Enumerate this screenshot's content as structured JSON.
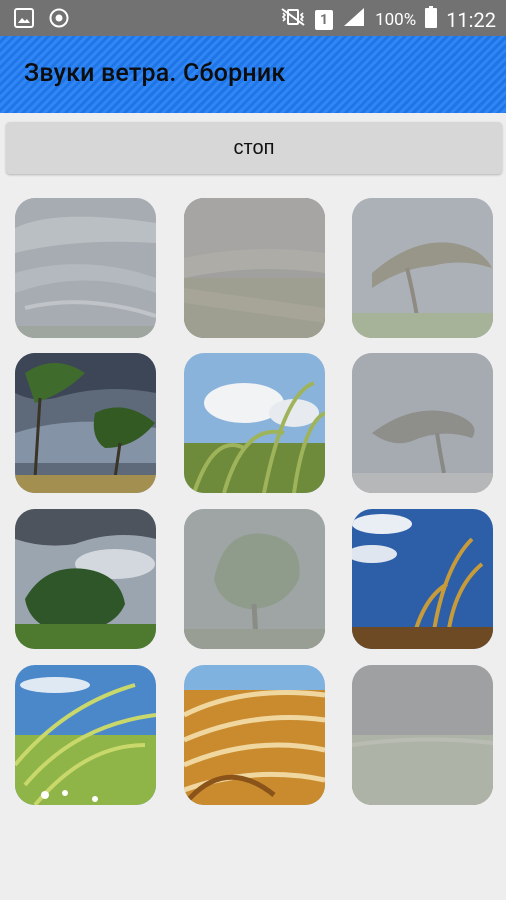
{
  "status_bar": {
    "left_icons": [
      "gallery-icon",
      "sync-icon"
    ],
    "mute_icon": "vibrate-icon",
    "sim_slot": "1",
    "signal_icon": "signal-icon",
    "battery_percent": "100%",
    "battery_icon": "battery-icon",
    "time": "11:22"
  },
  "app_bar": {
    "title": "Звуки ветра. Сборник",
    "color": "#2a80f0"
  },
  "stop_button": {
    "label": "стоп"
  },
  "sound_tiles": [
    {
      "id": "clouds-streaks",
      "active": false
    },
    {
      "id": "dust-field",
      "active": false
    },
    {
      "id": "windblown-tree-hill",
      "active": false
    },
    {
      "id": "bent-trees-storm",
      "active": true
    },
    {
      "id": "grass-sky-clouds",
      "active": true
    },
    {
      "id": "bare-tree-storm",
      "active": false
    },
    {
      "id": "green-tree-clouds",
      "active": true
    },
    {
      "id": "tree-fog",
      "active": false
    },
    {
      "id": "golden-grass-blue-sky",
      "active": true
    },
    {
      "id": "wheat-meadow",
      "active": true
    },
    {
      "id": "orange-grass",
      "active": true
    },
    {
      "id": "grey-sky-field",
      "active": false
    }
  ]
}
